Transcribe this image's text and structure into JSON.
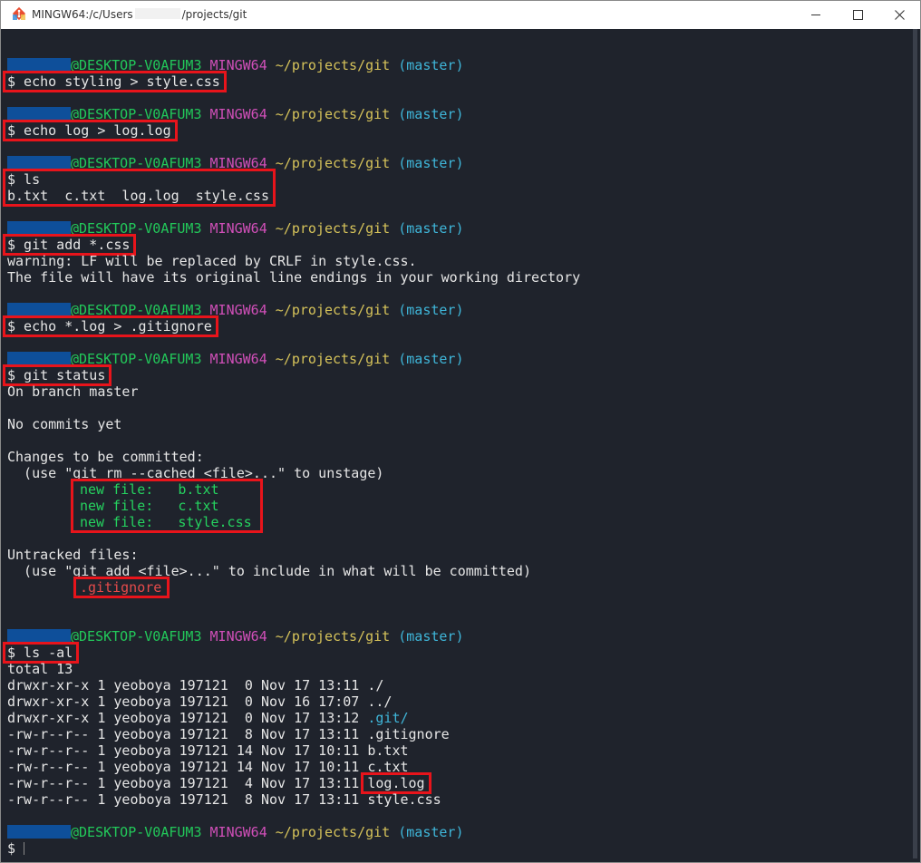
{
  "window": {
    "title_prefix": "MINGW64:/c/Users",
    "title_suffix": "/projects/git",
    "accent": "#e8141b"
  },
  "prompt": {
    "host": "@DESKTOP-V0AFUM3",
    "system": "MINGW64",
    "path": "~/projects/git",
    "branch": "(master)",
    "symbol": "$"
  },
  "blocks": [
    {
      "command": "$ echo styling > style.css",
      "output": []
    },
    {
      "command": "$ echo log > log.log",
      "output": []
    },
    {
      "command": "$ ls",
      "output": [
        "b.txt  c.txt  log.log  style.css"
      ]
    },
    {
      "command": "$ git add *.css",
      "output": [
        "warning: LF will be replaced by CRLF in style.css.",
        "The file will have its original line endings in your working directory"
      ]
    },
    {
      "command": "$ echo *.log > .gitignore",
      "output": []
    },
    {
      "command": "$ git status",
      "output": []
    },
    {
      "command": "$ ls -al",
      "output": []
    }
  ],
  "git_status": {
    "on_branch": "On branch master",
    "no_commits": "No commits yet",
    "changes_header": "Changes to be committed:",
    "changes_hint": "  (use \"git rm --cached <file>...\" to unstage)",
    "staged": [
      "new file:   b.txt",
      "new file:   c.txt",
      "new file:   style.css"
    ],
    "untracked_header": "Untracked files:",
    "untracked_hint": "  (use \"git add <file>...\" to include in what will be committed)",
    "untracked": [
      ".gitignore"
    ]
  },
  "ls_al": {
    "total": "total 13",
    "rows": [
      {
        "prefix": "drwxr-xr-x 1 yeoboya 197121  0 Nov 17 13:11 ",
        "name": "./"
      },
      {
        "prefix": "drwxr-xr-x 1 yeoboya 197121  0 Nov 16 17:07 ",
        "name": "../"
      },
      {
        "prefix": "drwxr-xr-x 1 yeoboya 197121  0 Nov 17 13:12 ",
        "name": ".git/"
      },
      {
        "prefix": "-rw-r--r-- 1 yeoboya 197121  8 Nov 17 13:11 ",
        "name": ".gitignore"
      },
      {
        "prefix": "-rw-r--r-- 1 yeoboya 197121 14 Nov 17 10:11 ",
        "name": "b.txt"
      },
      {
        "prefix": "-rw-r--r-- 1 yeoboya 197121 14 Nov 17 10:11 ",
        "name": "c.txt"
      },
      {
        "prefix": "-rw-r--r-- 1 yeoboya 197121  4 Nov 17 13:11 ",
        "name": "log.log"
      },
      {
        "prefix": "-rw-r--r-- 1 yeoboya 197121  8 Nov 17 13:11 ",
        "name": "style.css"
      }
    ]
  },
  "final_prompt_symbol": "$"
}
